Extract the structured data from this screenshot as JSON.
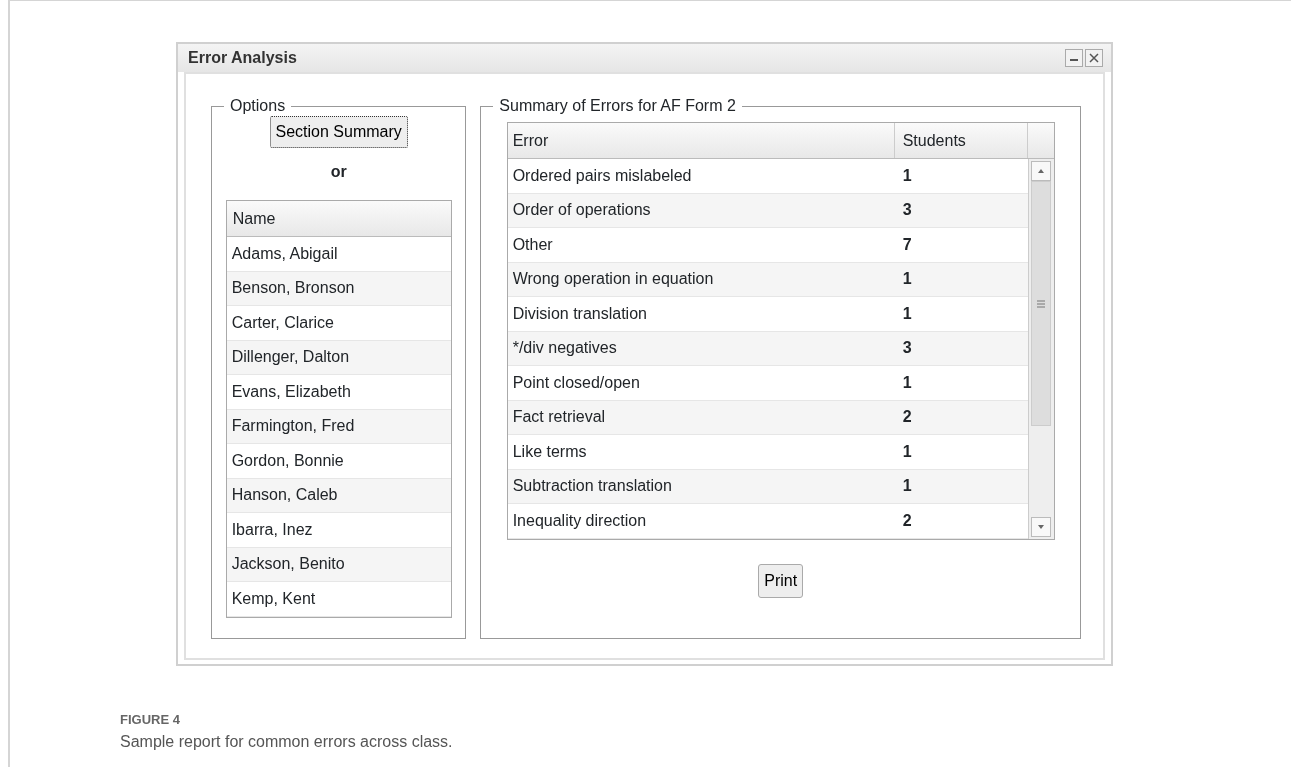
{
  "window": {
    "title": "Error Analysis"
  },
  "options": {
    "legend": "Options",
    "button": "Section Summary",
    "separator": "or",
    "name_list": {
      "header": "Name",
      "rows": [
        "Adams, Abigail",
        "Benson, Bronson",
        "Carter, Clarice",
        "Dillenger, Dalton",
        "Evans, Elizabeth",
        "Farmington, Fred",
        "Gordon, Bonnie",
        "Hanson, Caleb",
        "Ibarra, Inez",
        "Jackson, Benito",
        "Kemp, Kent"
      ]
    }
  },
  "summary": {
    "legend": "Summary of Errors for AF Form 2",
    "table": {
      "columns": [
        "Error",
        "Students"
      ],
      "rows": [
        {
          "error": "Ordered pairs mislabeled",
          "students": "1"
        },
        {
          "error": "Order of operations",
          "students": "3"
        },
        {
          "error": "Other",
          "students": "7"
        },
        {
          "error": "Wrong operation in equation",
          "students": "1"
        },
        {
          "error": "Division translation",
          "students": "1"
        },
        {
          "error": "*/div negatives",
          "students": "3"
        },
        {
          "error": "Point closed/open",
          "students": "1"
        },
        {
          "error": "Fact retrieval",
          "students": "2"
        },
        {
          "error": "Like terms",
          "students": "1"
        },
        {
          "error": "Subtraction translation",
          "students": "1"
        },
        {
          "error": "Inequality direction",
          "students": "2"
        }
      ]
    },
    "print_button": "Print"
  },
  "figure": {
    "label": "FIGURE 4",
    "caption": "Sample report for common errors across class."
  }
}
